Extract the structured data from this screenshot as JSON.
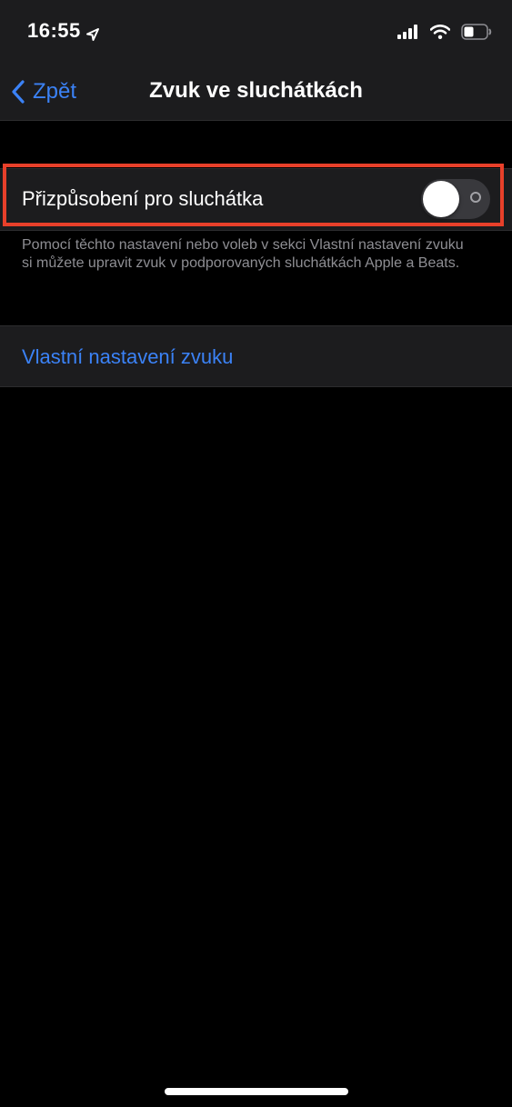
{
  "status_bar": {
    "time": "16:55",
    "icons": [
      "location-arrow-icon",
      "cellular-signal-icon",
      "wifi-icon",
      "battery-icon"
    ]
  },
  "nav": {
    "back_label": "Zpět",
    "title": "Zvuk ve sluchátkách"
  },
  "settings": {
    "headphone_accommodations": {
      "label": "Přizpůsobení pro sluchátka",
      "enabled": false
    },
    "footer": "Pomocí těchto nastavení nebo voleb v sekci Vlastní nastavení zvuku si můžete upravit zvuk v podporovaných sluchátkách Apple a Beats.",
    "custom_audio_link": "Vlastní nastavení zvuku"
  },
  "colors": {
    "accent": "#3b82f6",
    "highlight": "#e8402a",
    "background": "#000000",
    "cell": "#1c1c1e",
    "secondary_text": "#8e8e93"
  }
}
